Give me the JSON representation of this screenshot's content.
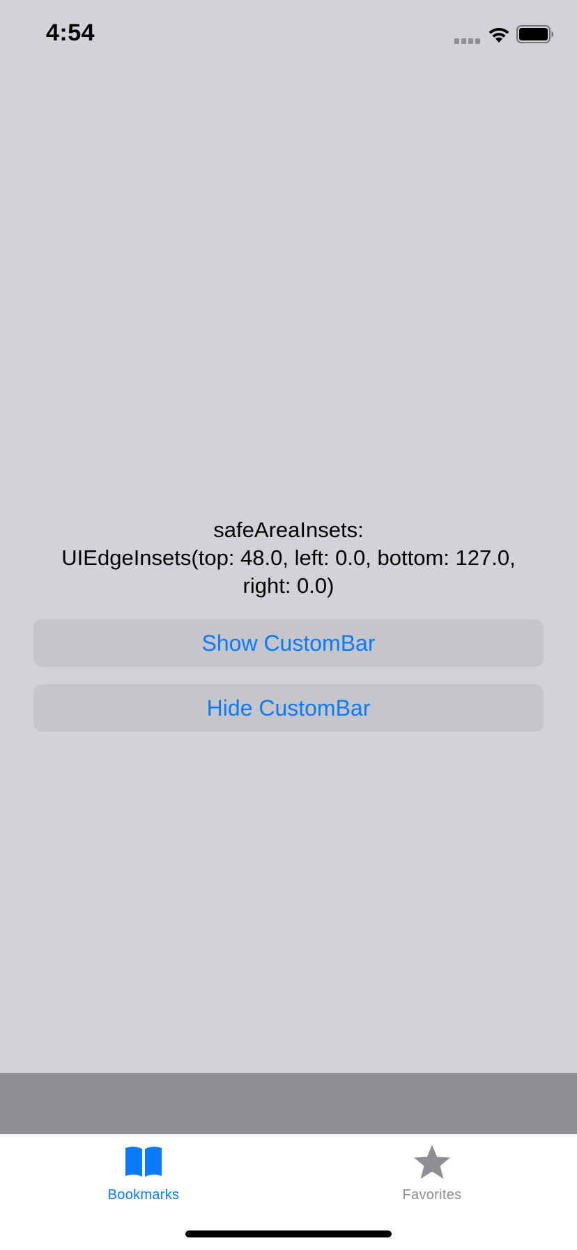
{
  "status_bar": {
    "time": "4:54"
  },
  "main": {
    "insets_text": "safeAreaInsets:\nUIEdgeInsets(top: 48.0, left: 0.0, bottom: 127.0,\nright: 0.0)",
    "show_button_label": "Show CustomBar",
    "hide_button_label": "Hide CustomBar"
  },
  "tab_bar": {
    "tabs": [
      {
        "label": "Bookmarks",
        "icon": "book-icon",
        "selected": true
      },
      {
        "label": "Favorites",
        "icon": "star-icon",
        "selected": false
      }
    ]
  },
  "colors": {
    "background": "#d2d2d7",
    "accent": "#0a7aff",
    "button_background": "#c5c5ca",
    "custom_bar": "#8e8e93",
    "inactive_tab": "#8e8e93"
  }
}
